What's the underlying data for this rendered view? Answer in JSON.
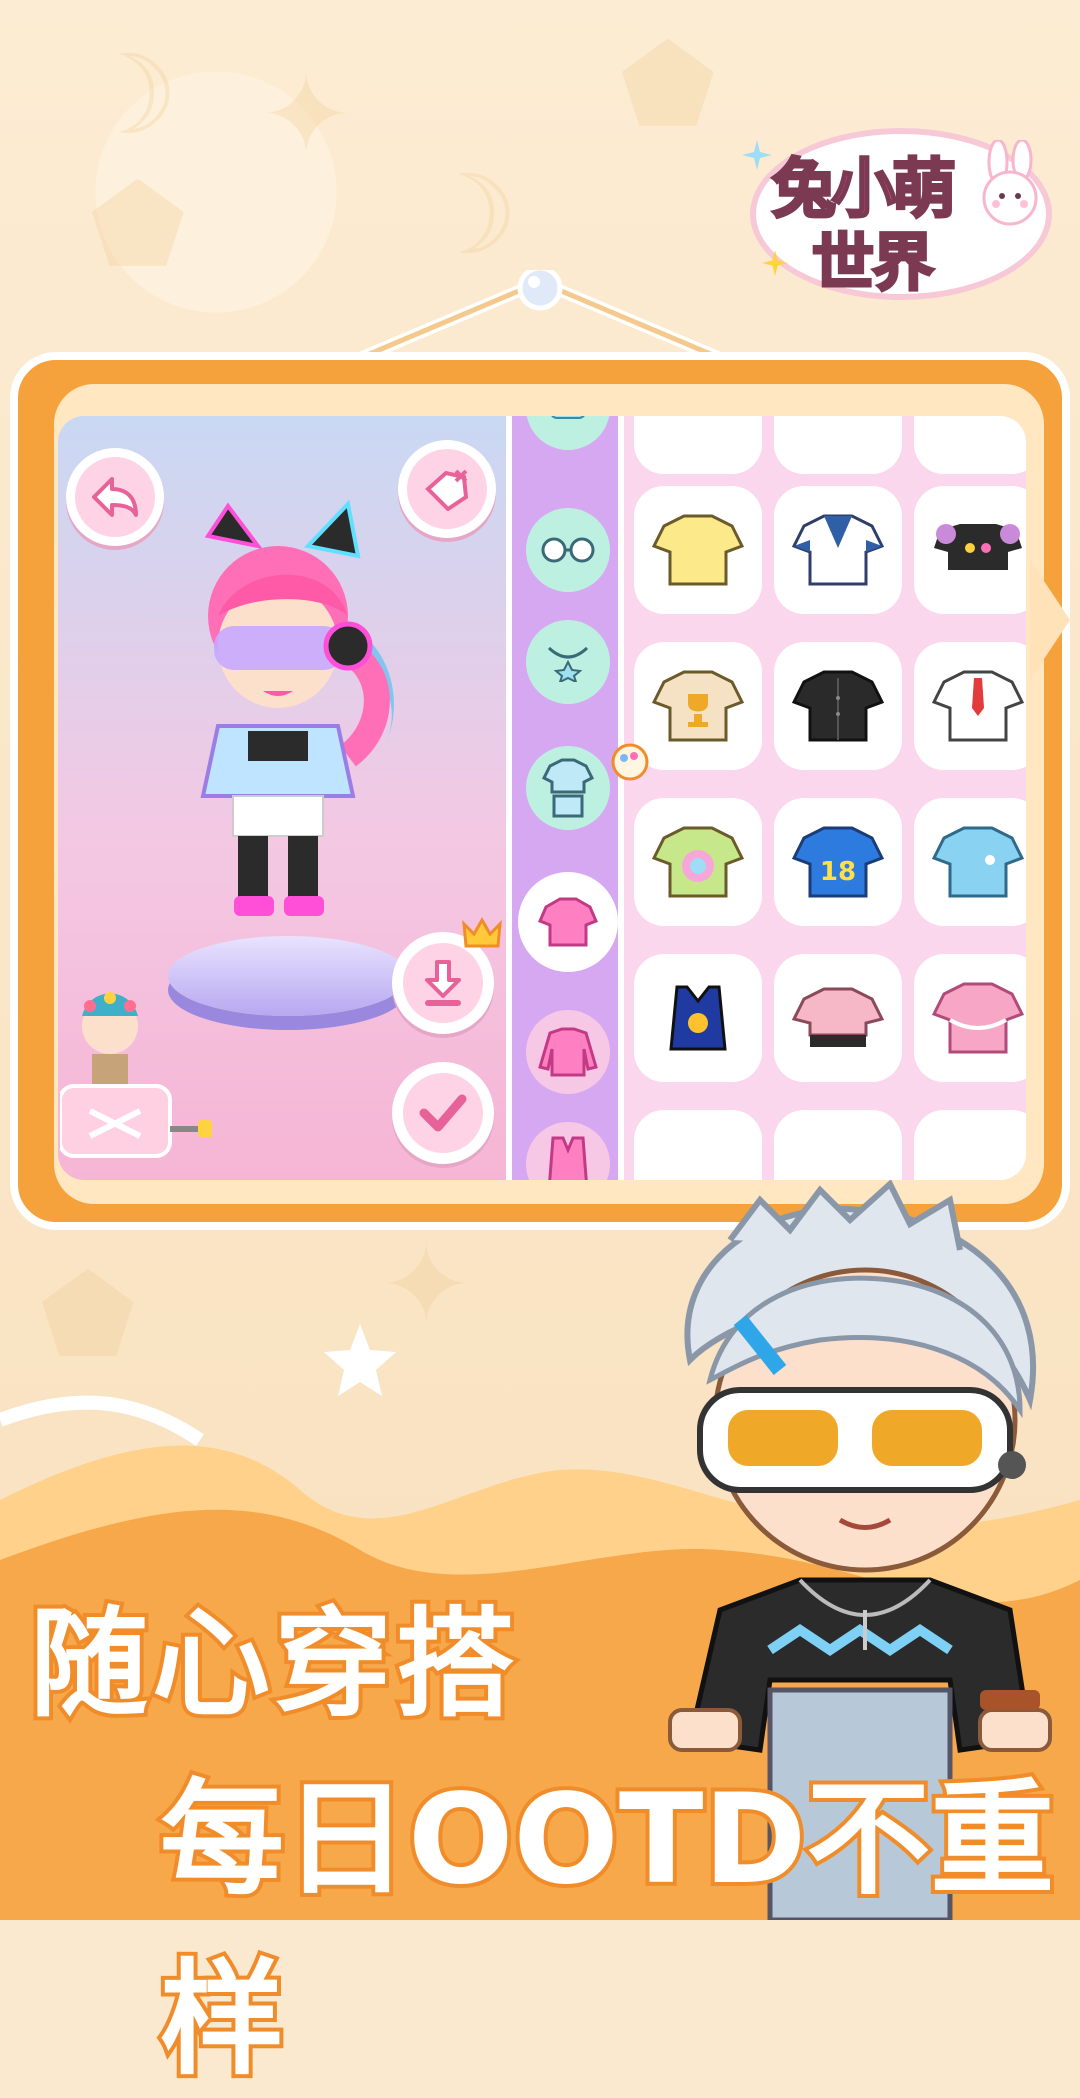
{
  "logo": {
    "line1": "兔小萌",
    "line2": "世界"
  },
  "slogan": {
    "line1": "随心穿搭",
    "line2": "每日OOTD不重样"
  },
  "stage": {
    "back_icon": "back-arrow-icon",
    "tag_icon": "price-tag-icon",
    "save_icon": "download-icon",
    "confirm_icon": "checkmark-icon",
    "random_icon": "shuffle-icon",
    "crown_icon": "crown-icon"
  },
  "categories": [
    {
      "icon": "hat-icon"
    },
    {
      "icon": "glasses-icon"
    },
    {
      "icon": "necklace-icon"
    },
    {
      "icon": "outfit-set-icon"
    },
    {
      "icon": "tshirt-icon",
      "selected": true
    },
    {
      "icon": "sweater-icon"
    },
    {
      "icon": "vest-icon"
    }
  ],
  "items": [
    {
      "icon": "yellow-tee",
      "color": "#fbe98a"
    },
    {
      "icon": "sailor-shirt",
      "color": "#2f5fa6"
    },
    {
      "icon": "heart-crop-top",
      "color": "#2b2b2b"
    },
    {
      "icon": "trophy-tee",
      "color": "#f5e2c4"
    },
    {
      "icon": "black-shirt",
      "color": "#2a2a2a"
    },
    {
      "icon": "white-shirt-tie",
      "color": "#ffffff"
    },
    {
      "icon": "tie-dye-tee",
      "color": "#c6e88a"
    },
    {
      "icon": "jersey-18",
      "color": "#2e7be0",
      "label": "18"
    },
    {
      "icon": "blue-tee",
      "color": "#8ad2f2"
    },
    {
      "icon": "tank-top",
      "color": "#1f3aa0"
    },
    {
      "icon": "pink-crop",
      "color": "#f6b7c6"
    },
    {
      "icon": "pink-blouse",
      "color": "#f7a6c6"
    }
  ]
}
